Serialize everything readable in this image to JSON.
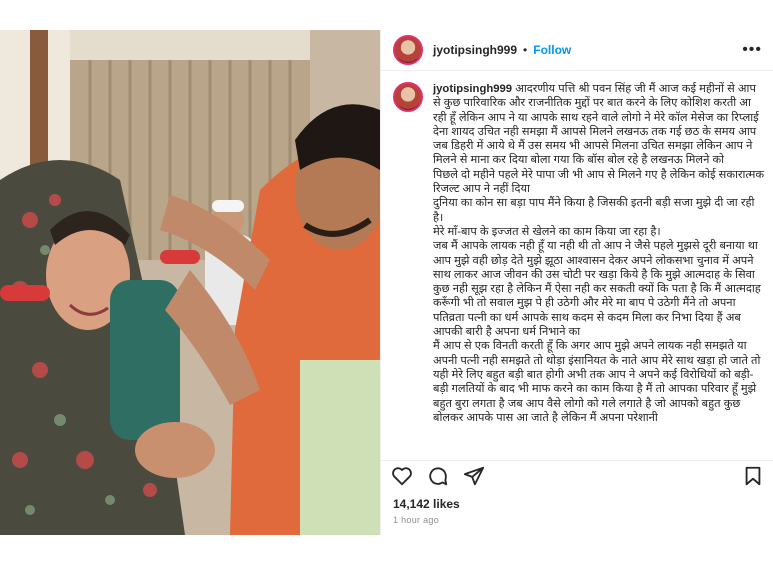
{
  "post": {
    "username": "jyotipsingh999",
    "separator": "•",
    "follow_label": "Follow",
    "more_label": "•••",
    "caption_lines": [
      "आदरणीय पत्ति श्री पवन सिंह जी मैं आज कई महीनों से आप से कुछ पारिवारिक और राजनीतिक मुद्दों पर बात करने के लिए कोशिश करती आ रही हूँ लेकिन आप ने या आपके साथ रहने वाले लोगो ने मेरे कॉल मेसेज का रिप्लाई देना शायद उचित नही समझा मैं आपसे मिलने लखनऊ तक गई छठ के समय आप जब डिहरी में आये थे मैं उस समय भी आपसे मिलना उचित समझा लेकिन आप ने मिलने से माना कर दिया बोला गया कि बॉस बोल रहे है लखनऊ मिलने को",
      "पिछले दो महीने पहले मेरे पापा जी भी आप से मिलने गए है लेकिन कोई सकारात्मक रिजल्ट आप ने नहीं दिया",
      "दुनिया का कोन सा बड़ा पाप मैंने किया है जिसकी इतनी बड़ी सजा मुझे दी जा रही है।",
      "मेरे माँ-बाप के इज्जत से खेलने का काम किया जा रहा है।",
      "जब मैं आपके लायक नही हूँ या नही थी तो आप ने जैसे पहले मुझसे दूरी बनाया था आप मुझे वही छोड़ देते मुझे झूठा आश्वासन देकर अपने लोकसभा चुनाव में अपने साथ लाकर आज जीवन की उस चोटी पर खड़ा किये है कि मुझे आत्मदाह के सिवा कुछ नही सूझ रहा है लेकिन मैं ऐसा नही कर सकती क्यों कि पता है कि मैं आत्मदाह करूँगी भी तो सवाल मुझ पे ही उठेगी और मेरे मा बाप पे उठेगी मैंने तो अपना पतिव्रता पत्नी का धर्म आपके साथ कदम से कदम मिला कर निभा दिया हैं अब आपकी बारी है अपना धर्म निभाने का",
      "मैं आप से एक विनती करती हूँ कि अगर आप मुझे अपने लायक नही समझते या अपनी पत्नी नही समझते तो थोड़ा इंसानियत के नाते आप मेरे साथ खड़ा हो जाते तो यही मेरे लिए बहुत बड़ी बात होगी अभी तक आप ने अपने कई विरोधियों को बड़ी-बड़ी गलतियों के बाद भी माफ करने का काम किया है मैं तो आपका परिवार हूँ मुझे बहुत बुरा लगता है जब आप वैसे लोगो को गले लगाते है जो आपको बहुत कुछ बोलकर आपके पास आ जाते है लेकिन मैं अपना परेशानी"
    ],
    "likes": "14,142 likes",
    "time_ago": "1 hour ago"
  },
  "icons": {
    "like": "heart-icon",
    "comment": "comment-icon",
    "share": "paper-plane-icon",
    "save": "bookmark-icon"
  },
  "colors": {
    "follow": "#0095f6",
    "avatar_ring": "#e1306c",
    "text": "#262626",
    "muted": "#8e8e8e"
  }
}
